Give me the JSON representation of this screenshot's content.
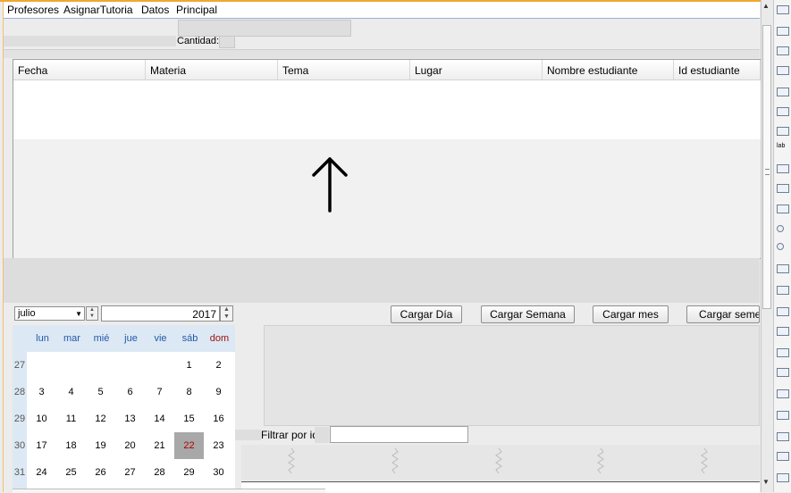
{
  "menu": {
    "items": [
      "Profesores",
      "AsignarTutoria",
      "Datos",
      "Principal"
    ]
  },
  "cantidad_label": "Cantidad:",
  "table": {
    "columns": [
      "Fecha",
      "Materia",
      "Tema",
      "Lugar",
      "Nombre estudiante",
      "Id estudiante"
    ]
  },
  "month_select": {
    "value": "julio"
  },
  "year_spinner": {
    "value": "2017"
  },
  "buttons": {
    "cargar_dia": "Cargar Día",
    "cargar_semana": "Cargar Semana",
    "cargar_mes": "Cargar mes",
    "cargar_semestre": "Cargar semes"
  },
  "filter": {
    "label": "Filtrar por id",
    "value": ""
  },
  "calendar": {
    "day_names": [
      "lun",
      "mar",
      "mié",
      "jue",
      "vie",
      "sáb",
      "dom"
    ],
    "weeks": [
      {
        "num": "27",
        "days": [
          "",
          "",
          "",
          "",
          "",
          "1",
          "2"
        ]
      },
      {
        "num": "28",
        "days": [
          "3",
          "4",
          "5",
          "6",
          "7",
          "8",
          "9"
        ]
      },
      {
        "num": "29",
        "days": [
          "10",
          "11",
          "12",
          "13",
          "14",
          "15",
          "16"
        ]
      },
      {
        "num": "30",
        "days": [
          "17",
          "18",
          "19",
          "20",
          "21",
          "22",
          "23"
        ]
      },
      {
        "num": "31",
        "days": [
          "24",
          "25",
          "26",
          "27",
          "28",
          "29",
          "30"
        ]
      }
    ],
    "selected_day": "22",
    "colors": {
      "header_bg": "#dce9f5",
      "dayname": "#2457a8",
      "sunday": "#a01010",
      "selected_bg": "#a8a8a8",
      "selected_text": "#b00000"
    }
  },
  "colors": {
    "accent_line": "#f0a830"
  },
  "icons": {
    "arrow": "arrow-up-icon"
  }
}
